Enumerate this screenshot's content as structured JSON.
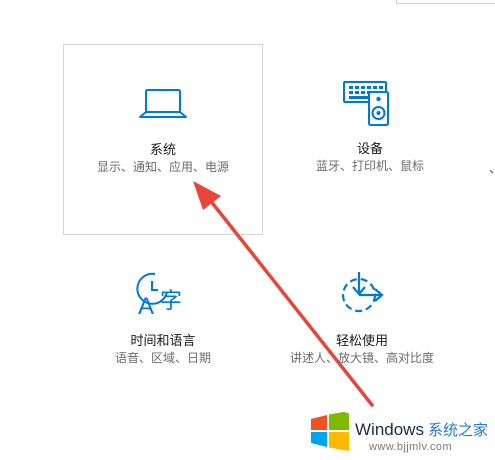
{
  "tiles": {
    "system": {
      "title": "系统",
      "subtitle": "显示、通知、应用、电源",
      "icon": "laptop-icon"
    },
    "devices": {
      "title": "设备",
      "subtitle": "蓝牙、打印机、鼠标",
      "icon": "keyboard-speaker-icon"
    },
    "time_language": {
      "title": "时间和语言",
      "subtitle": "语音、区域、日期",
      "icon": "clock-language-icon"
    },
    "ease_of_access": {
      "title": "轻松使用",
      "subtitle": "讲述人、放大镜、高对比度",
      "icon": "timer-access-icon"
    }
  },
  "watermark": {
    "brand": "Windows",
    "brand_cn": "系统之家",
    "url": "www.bjjmlv.com"
  },
  "colors": {
    "accent": "#0078d7",
    "arrow": "#e8443a"
  }
}
